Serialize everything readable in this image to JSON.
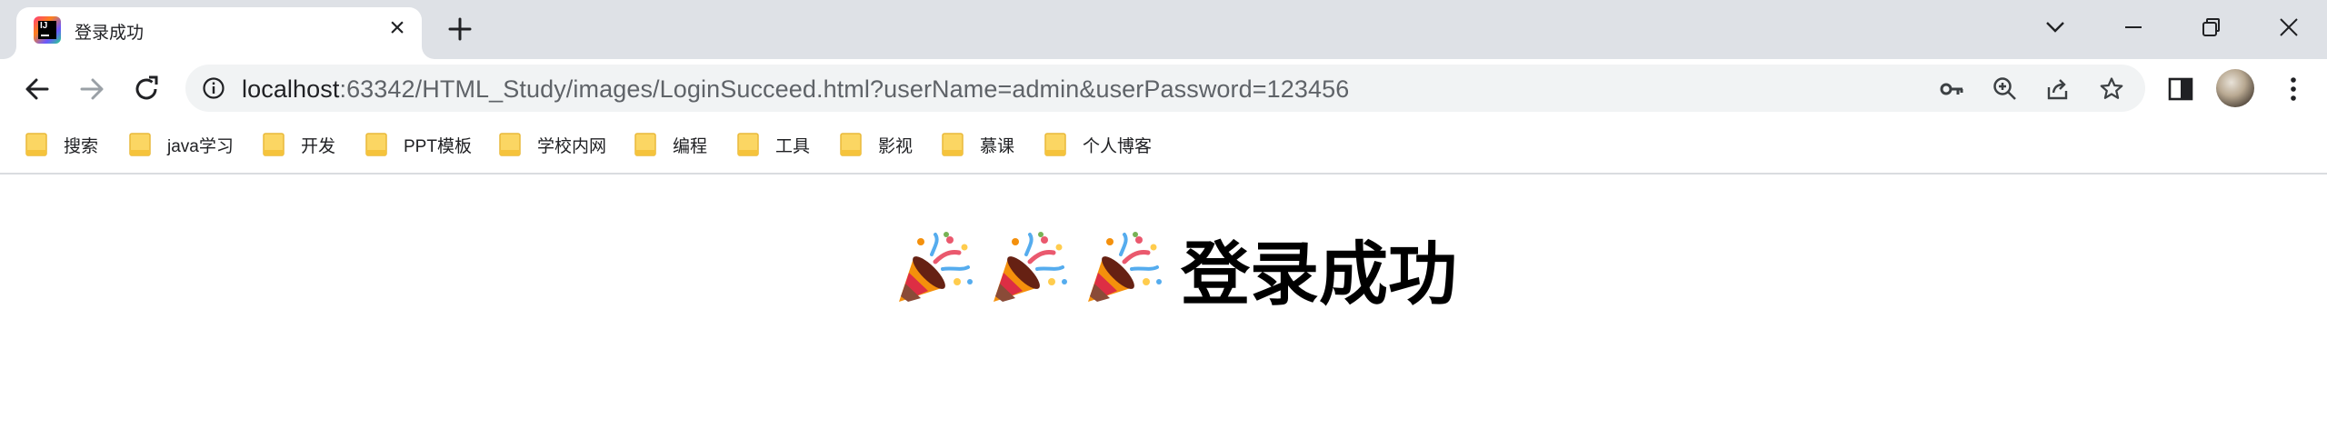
{
  "tab": {
    "title": "登录成功",
    "close_glyph": "×"
  },
  "address_bar": {
    "url_host": "localhost",
    "url_rest": ":63342/HTML_Study/images/LoginSucceed.html?userName=admin&userPassword=123456"
  },
  "bookmarks": [
    {
      "label": "搜索"
    },
    {
      "label": "java学习"
    },
    {
      "label": "开发"
    },
    {
      "label": "PPT模板"
    },
    {
      "label": "学校内网"
    },
    {
      "label": "编程"
    },
    {
      "label": "工具"
    },
    {
      "label": "影视"
    },
    {
      "label": "慕课"
    },
    {
      "label": "个人博客"
    }
  ],
  "page": {
    "heading_emoji": [
      "party-popper-icon",
      "party-popper-icon",
      "party-popper-icon"
    ],
    "heading_text": "登录成功"
  },
  "colors": {
    "tabstrip": "#dee1e6",
    "omnibox": "#f1f3f4",
    "folder": "#fbd663"
  }
}
